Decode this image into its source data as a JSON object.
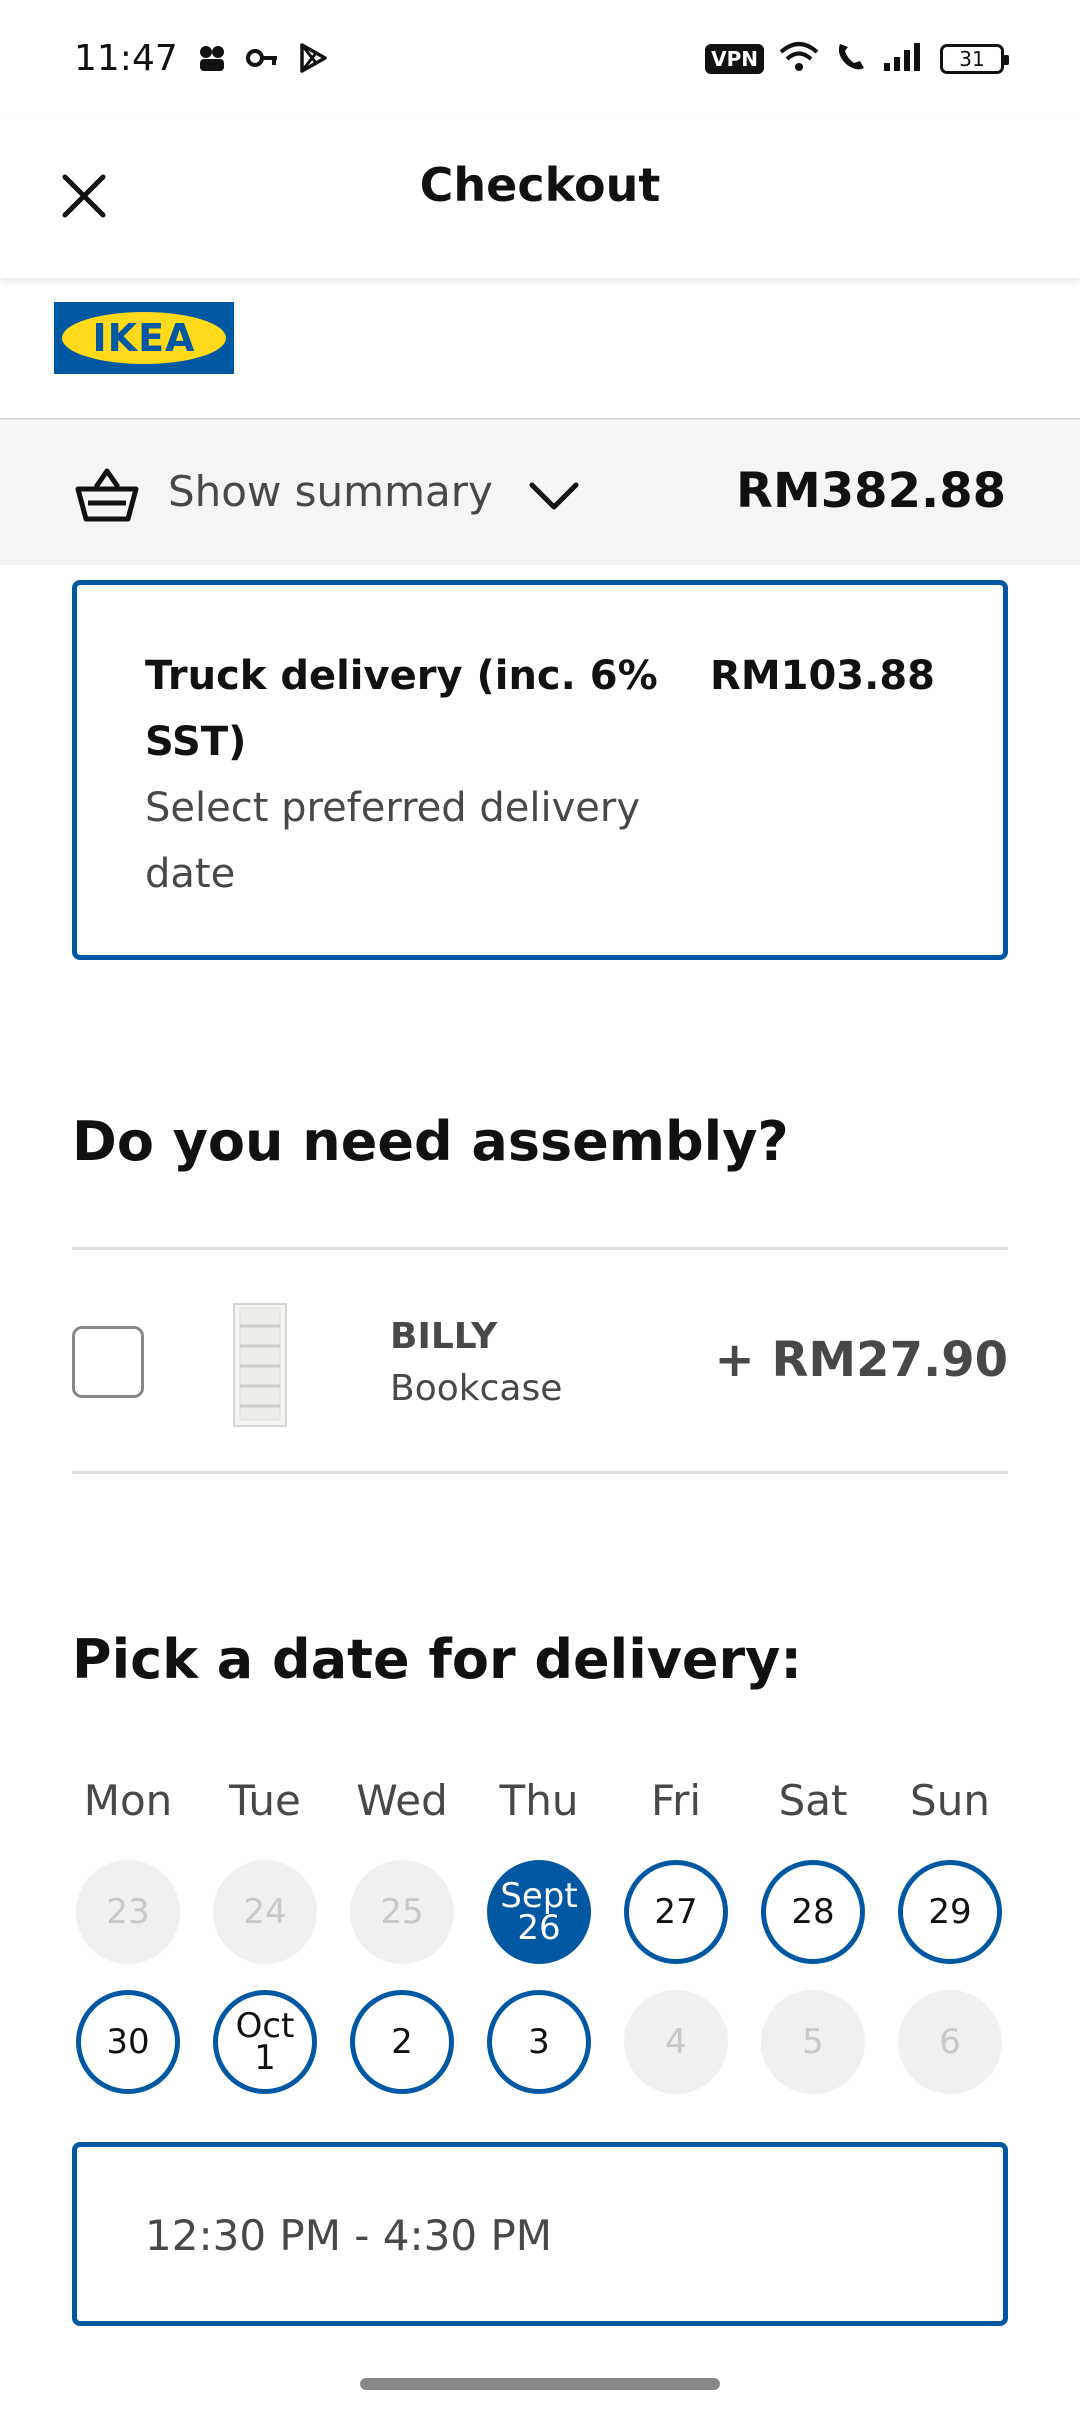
{
  "status_bar": {
    "time": "11:47",
    "vpn": "VPN",
    "battery": "31"
  },
  "header": {
    "title": "Checkout"
  },
  "logo": {
    "text": "IKEA",
    "colors": {
      "blue": "#0058a3",
      "yellow": "#ffda1a"
    }
  },
  "summary": {
    "label": "Show summary",
    "total": "RM382.88"
  },
  "delivery": {
    "title": "Truck delivery (inc. 6% SST)",
    "subtitle": "Select preferred delivery date",
    "price": "RM103.88"
  },
  "assembly": {
    "heading": "Do you need assembly?",
    "product_name": "BILLY",
    "product_desc": "Bookcase",
    "price": "+ RM27.90"
  },
  "date_picker": {
    "heading": "Pick a date for delivery:",
    "weekdays": [
      "Mon",
      "Tue",
      "Wed",
      "Thu",
      "Fri",
      "Sat",
      "Sun"
    ],
    "week1": [
      {
        "label": "23",
        "state": "disabled"
      },
      {
        "label": "24",
        "state": "disabled"
      },
      {
        "label": "25",
        "state": "disabled"
      },
      {
        "month": "Sept",
        "label": "26",
        "state": "selected"
      },
      {
        "label": "27",
        "state": "available"
      },
      {
        "label": "28",
        "state": "available"
      },
      {
        "label": "29",
        "state": "available"
      }
    ],
    "week2": [
      {
        "label": "30",
        "state": "available"
      },
      {
        "month": "Oct",
        "label": "1",
        "state": "available"
      },
      {
        "label": "2",
        "state": "available"
      },
      {
        "label": "3",
        "state": "available"
      },
      {
        "label": "4",
        "state": "disabled"
      },
      {
        "label": "5",
        "state": "disabled"
      },
      {
        "label": "6",
        "state": "disabled"
      }
    ]
  },
  "time_slot": {
    "value": "12:30 PM - 4:30 PM"
  },
  "colors": {
    "accent": "#0058a3",
    "disabled_bg": "#f0f0f0",
    "summary_bg": "#f5f5f5"
  }
}
